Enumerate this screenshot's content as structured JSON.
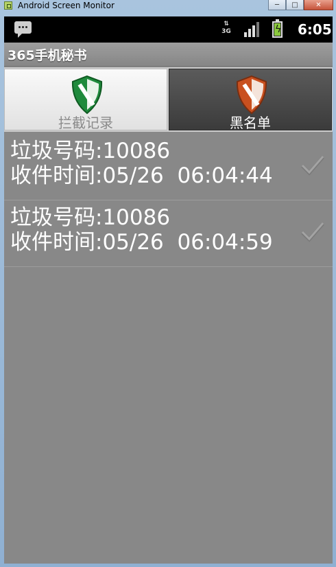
{
  "window": {
    "title": "Android Screen Monitor",
    "buttons": {
      "minimize": "─",
      "maximize": "□",
      "close": "✕"
    }
  },
  "status_bar": {
    "network_type": "3G",
    "time": "6:05",
    "icons": [
      "notification-icon",
      "data-3g-icon",
      "signal-icon",
      "battery-charging-icon"
    ]
  },
  "app": {
    "title": "365手机秘书"
  },
  "tabs": [
    {
      "label": "拦截记录",
      "icon": "green-shield-icon",
      "selected": false
    },
    {
      "label": "黑名单",
      "icon": "orange-shield-icon",
      "selected": true
    }
  ],
  "messages": [
    {
      "line1": "垃圾号码:10086",
      "line2": "收件时间:05/26  06:04:44",
      "checked": true
    },
    {
      "line1": "垃圾号码:10086",
      "line2": "收件时间:05/26  06:04:59",
      "checked": true
    }
  ],
  "colors": {
    "shield_green": "#1f8a3c",
    "shield_orange": "#c9501f"
  }
}
